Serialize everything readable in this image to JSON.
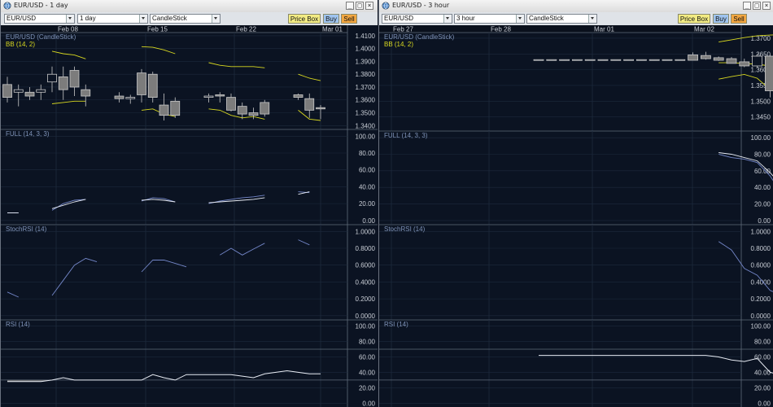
{
  "colors": {
    "background": "#0b1322",
    "grid": "#1d2a3c",
    "separator": "#5f6b7a",
    "axis_text": "#c9ced6",
    "label_text": "#7f93b8",
    "bollinger": "#d8d820",
    "candle_up": "#0b1322",
    "candle_down": "#7c7c7c",
    "candle_outline": "#c9c9c9",
    "indicator_line_1": "#e8ecf4",
    "indicator_line_2": "#7386c8",
    "price_box_button": "#f2eb83",
    "buy_button": "#9fc4ef",
    "sell_button": "#f2a640"
  },
  "windows": [
    {
      "title": "EUR/USD - 1 day",
      "window_icon": "globe-icon",
      "controls": {
        "minimize": "_",
        "maximize": "□",
        "close": "×"
      },
      "toolbar": {
        "symbol": "EUR/USD",
        "interval": "1 day",
        "chart_style": "CandleStick",
        "price_box": "Price Box",
        "buy": "Buy",
        "sell": "Sell"
      },
      "chart_data": {
        "type": "candlestick",
        "x_tick_labels": [
          "Feb 08",
          "Feb 15",
          "Feb 22",
          "Mar 01"
        ],
        "panels": [
          {
            "name": "price",
            "labels": [
              "EUR/USD (CandleStick)",
              "BB (14, 2)"
            ],
            "y_ticks": [
              "1.4100",
              "1.4000",
              "1.3900",
              "1.3800",
              "1.3700",
              "1.3600",
              "1.3500",
              "1.3400"
            ],
            "y_range": [
              1.337,
              1.4125
            ],
            "ohlc": [
              [
                1.372,
                1.378,
                1.358,
                1.362
              ],
              [
                1.366,
                1.372,
                1.355,
                1.368
              ],
              [
                1.366,
                1.37,
                1.36,
                1.363
              ],
              [
                1.366,
                1.372,
                1.36,
                1.368
              ],
              [
                1.374,
                1.386,
                1.366,
                1.38
              ],
              [
                1.378,
                1.386,
                1.36,
                1.368
              ],
              [
                1.383,
                1.386,
                1.363,
                1.37
              ],
              [
                1.368,
                1.372,
                1.355,
                1.363
              ],
              null,
              null,
              [
                1.363,
                1.366,
                1.358,
                1.361
              ],
              [
                1.361,
                1.364,
                1.357,
                1.362
              ],
              [
                1.381,
                1.384,
                1.358,
                1.364
              ],
              [
                1.38,
                1.382,
                1.358,
                1.362
              ],
              [
                1.356,
                1.365,
                1.344,
                1.348
              ],
              [
                1.359,
                1.362,
                1.346,
                1.348
              ],
              null,
              null,
              [
                1.362,
                1.365,
                1.358,
                1.363
              ],
              [
                1.364,
                1.366,
                1.358,
                1.363
              ],
              [
                1.362,
                1.365,
                1.351,
                1.352
              ],
              [
                1.355,
                1.358,
                1.345,
                1.349
              ],
              [
                1.35,
                1.354,
                1.345,
                1.348
              ],
              [
                1.358,
                1.36,
                1.347,
                1.349
              ],
              null,
              null,
              [
                1.364,
                1.365,
                1.36,
                1.362
              ],
              [
                1.361,
                1.365,
                1.346,
                1.352
              ],
              [
                1.354,
                1.356,
                1.345,
                1.353
              ]
            ],
            "bb_upper": [
              null,
              null,
              null,
              null,
              1.398,
              1.396,
              1.395,
              1.392,
              null,
              null,
              null,
              null,
              1.4015,
              1.401,
              1.399,
              1.396,
              null,
              null,
              1.389,
              1.387,
              1.386,
              1.386,
              1.386,
              1.385,
              null,
              null,
              1.38,
              1.377,
              1.375
            ],
            "bb_lower": [
              null,
              null,
              null,
              null,
              1.357,
              1.358,
              1.359,
              1.359,
              null,
              null,
              null,
              null,
              1.352,
              1.353,
              1.349,
              1.347,
              null,
              null,
              1.353,
              1.352,
              1.348,
              1.346,
              1.347,
              1.345,
              null,
              null,
              1.352,
              1.345,
              1.344
            ]
          },
          {
            "name": "full_stochastic",
            "labels": [
              "FULL (14, 3, 3)"
            ],
            "y_ticks": [
              "100.00",
              "80.00",
              "60.00",
              "40.00",
              "20.00",
              "0.00"
            ],
            "y_range": [
              -5,
              108
            ],
            "line_1": [
              9,
              9,
              null,
              null,
              14,
              18,
              22,
              25,
              null,
              null,
              null,
              null,
              24,
              25,
              24,
              22,
              null,
              null,
              21,
              22,
              23,
              24,
              25,
              27,
              null,
              null,
              31,
              34,
              null
            ],
            "line_2": [
              9,
              9,
              null,
              null,
              12,
              20,
              24,
              25,
              null,
              null,
              null,
              null,
              23,
              27,
              26,
              22,
              null,
              null,
              20,
              23,
              25,
              27,
              28,
              30,
              null,
              null,
              34,
              33,
              null
            ]
          },
          {
            "name": "stoch_rsi",
            "labels": [
              "StochRSI (14)"
            ],
            "y_ticks": [
              "1.0000",
              "0.8000",
              "0.6000",
              "0.4000",
              "0.2000",
              "0.0000"
            ],
            "y_range": [
              -0.05,
              1.08
            ],
            "line_1": [
              0.28,
              0.22,
              null,
              null,
              0.24,
              0.42,
              0.6,
              0.68,
              0.64,
              null,
              null,
              null,
              0.52,
              0.66,
              0.66,
              0.62,
              0.58,
              null,
              null,
              0.72,
              0.8,
              0.72,
              0.79,
              0.86,
              null,
              null,
              0.9,
              0.84,
              null
            ]
          },
          {
            "name": "rsi",
            "labels": [
              "RSI (14)"
            ],
            "y_ticks": [
              "100.00",
              "80.00",
              "60.00",
              "40.00",
              "20.00",
              "0.00"
            ],
            "y_range": [
              -5,
              108
            ],
            "levels": [
              70,
              30
            ],
            "line_1": [
              28,
              28,
              28,
              28,
              30,
              33,
              30,
              30,
              30,
              30,
              30,
              30,
              30,
              37,
              33,
              30,
              37,
              37,
              37,
              37,
              37,
              35,
              33,
              38,
              40,
              42,
              40,
              38,
              38
            ]
          }
        ]
      }
    },
    {
      "title": "EUR/USD - 3 hour",
      "window_icon": "globe-icon",
      "controls": {
        "minimize": "_",
        "maximize": "□",
        "close": "×"
      },
      "toolbar": {
        "symbol": "EUR/USD",
        "interval": "3 hour",
        "chart_style": "CandleStick",
        "price_box": "Price Box",
        "buy": "Buy",
        "sell": "Sell"
      },
      "chart_data": {
        "type": "candlestick",
        "x_tick_labels": [
          "Feb 27",
          "Feb 28",
          "Mar 01",
          "Mar 02"
        ],
        "panels": [
          {
            "name": "price",
            "labels": [
              "EUR/USD (CandleStick)",
              "BB (14, 2)"
            ],
            "y_ticks": [
              "1.3700",
              "1.3650",
              "1.3600",
              "1.3550",
              "1.3500",
              "1.3450"
            ],
            "y_range": [
              1.3405,
              1.3718
            ],
            "ohlc": [
              [
                1.3632,
                1.3632,
                1.3632,
                1.3632
              ],
              [
                1.3632,
                1.3632,
                1.3632,
                1.3632
              ],
              [
                1.3632,
                1.3632,
                1.3632,
                1.3632
              ],
              [
                1.3632,
                1.3632,
                1.3632,
                1.3632
              ],
              [
                1.3632,
                1.3632,
                1.3632,
                1.3632
              ],
              [
                1.3632,
                1.3632,
                1.3632,
                1.3632
              ],
              [
                1.3632,
                1.3632,
                1.3632,
                1.3632
              ],
              [
                1.3632,
                1.3632,
                1.3632,
                1.3632
              ],
              [
                1.3632,
                1.3632,
                1.3632,
                1.3632
              ],
              [
                1.3632,
                1.3632,
                1.3632,
                1.3632
              ],
              [
                1.3632,
                1.3632,
                1.3632,
                1.3632
              ],
              [
                1.3632,
                1.3632,
                1.3632,
                1.3632
              ],
              [
                1.3647,
                1.3655,
                1.363,
                1.363
              ],
              [
                1.3645,
                1.3657,
                1.3632,
                1.3635
              ],
              [
                1.3638,
                1.3642,
                1.3628,
                1.363
              ],
              [
                1.3635,
                1.364,
                1.362,
                1.362
              ],
              [
                1.3625,
                1.3635,
                1.3608,
                1.3612
              ],
              [
                1.3612,
                1.365,
                1.3605,
                1.3643
              ],
              [
                1.3643,
                1.3648,
                1.3512,
                1.3533
              ],
              [
                1.3533,
                1.355,
                1.347,
                1.3502
              ],
              [
                1.3502,
                1.3565,
                1.3495,
                1.3562
              ],
              [
                1.3565,
                1.358,
                1.3558,
                1.3565
              ],
              [
                1.3565,
                1.3582,
                1.3547,
                1.3548
              ],
              [
                1.3548,
                1.3552,
                1.3532,
                1.3533
              ],
              [
                1.3533,
                1.3537,
                1.3508,
                1.351
              ],
              [
                1.351,
                1.3515,
                1.3442,
                1.3497
              ],
              [
                1.3497,
                1.354,
                1.3495,
                1.3537
              ]
            ],
            "bb_upper": [
              null,
              null,
              null,
              null,
              null,
              null,
              null,
              null,
              null,
              null,
              null,
              null,
              null,
              null,
              1.3688,
              1.3695,
              1.3702,
              1.3708,
              1.371,
              1.3712,
              1.3712,
              1.3712,
              1.3712,
              1.3712,
              1.3705,
              1.37,
              1.369
            ],
            "bb_lower": [
              null,
              null,
              null,
              null,
              null,
              null,
              null,
              null,
              null,
              null,
              null,
              null,
              null,
              null,
              1.357,
              1.3578,
              1.3585,
              1.3573,
              1.3537,
              1.352,
              1.352,
              1.3522,
              1.352,
              1.3512,
              1.3485,
              1.3465,
              1.3462
            ],
            "bb_middle": [
              null,
              null,
              null,
              null,
              null,
              null,
              null,
              null,
              null,
              null,
              null,
              null,
              null,
              null,
              1.3622,
              1.3622,
              1.362,
              1.3617,
              1.3612,
              1.3608,
              1.3603,
              1.36,
              1.3595,
              1.359,
              1.3585,
              1.3575,
              1.3565
            ]
          },
          {
            "name": "full_stochastic",
            "labels": [
              "FULL (14, 3, 3)"
            ],
            "y_ticks": [
              "100.00",
              "80.00",
              "60.00",
              "40.00",
              "20.00",
              "0.00"
            ],
            "y_range": [
              -5,
              108
            ],
            "line_1": [
              null,
              null,
              null,
              null,
              null,
              null,
              null,
              null,
              null,
              null,
              null,
              null,
              null,
              null,
              82,
              80,
              76,
              72,
              58,
              40,
              30,
              30,
              34,
              38,
              38,
              36,
              34,
              32,
              31
            ],
            "line_2": [
              null,
              null,
              null,
              null,
              null,
              null,
              null,
              null,
              null,
              null,
              null,
              null,
              null,
              null,
              80,
              76,
              74,
              70,
              54,
              30,
              20,
              34,
              42,
              40,
              36,
              30,
              32,
              32,
              32
            ]
          },
          {
            "name": "stoch_rsi",
            "labels": [
              "StochRSI (14)"
            ],
            "y_ticks": [
              "1.0000",
              "0.8000",
              "0.6000",
              "0.4000",
              "0.2000",
              "0.0000"
            ],
            "y_range": [
              -0.05,
              1.08
            ],
            "line_1": [
              null,
              null,
              null,
              null,
              null,
              null,
              null,
              null,
              null,
              null,
              null,
              null,
              null,
              null,
              0.88,
              0.78,
              0.56,
              0.48,
              0.3,
              0.24,
              0.16,
              0.3,
              0.4,
              0.36,
              0.32,
              0.26,
              0.3
            ]
          },
          {
            "name": "rsi",
            "labels": [
              "RSI (14)"
            ],
            "y_ticks": [
              "100.00",
              "80.00",
              "60.00",
              "40.00",
              "20.00",
              "0.00"
            ],
            "y_range": [
              -5,
              108
            ],
            "levels": [
              70,
              30
            ],
            "line_1": [
              62,
              62,
              62,
              62,
              62,
              62,
              62,
              62,
              62,
              62,
              62,
              62,
              62,
              62,
              60,
              56,
              54,
              58,
              40,
              36,
              42,
              48,
              46,
              44,
              42,
              40,
              46
            ]
          }
        ]
      }
    }
  ]
}
